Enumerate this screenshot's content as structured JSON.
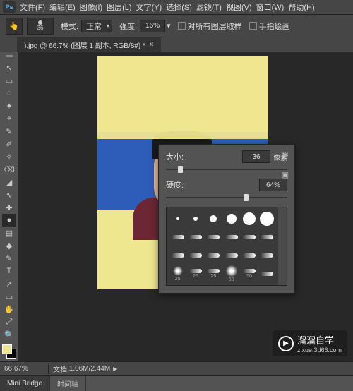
{
  "menubar": {
    "logo": "Ps",
    "items": [
      "文件(F)",
      "编辑(E)",
      "图像(I)",
      "图层(L)",
      "文字(Y)",
      "选择(S)",
      "滤镜(T)",
      "视图(V)",
      "窗口(W)",
      "帮助(H)"
    ]
  },
  "optionbar": {
    "brush_size_chip": "36",
    "mode_label": "模式:",
    "mode_value": "正常",
    "strength_label": "强度:",
    "strength_value": "16%",
    "sample_all_label": "对所有图层取样",
    "finger_paint_label": "手指绘画"
  },
  "tab": {
    "title": ").jpg @ 66.7% (图层 1 副本, RGB/8#) *"
  },
  "toolbox": {
    "tools": [
      "↖",
      "▭",
      "◌",
      "✦",
      "⌖",
      "✎",
      "✐",
      "⟡",
      "⌫",
      "◢",
      "∿",
      "✚",
      "●",
      "▤",
      "◆",
      "✎",
      "T",
      "↗",
      "▭",
      "✋",
      "⤢",
      "🔍"
    ],
    "active_index": 12,
    "fg_color": "#efe690"
  },
  "brush_panel": {
    "size_label": "大小:",
    "size_value": "36",
    "size_unit": "像素",
    "size_pct": 10,
    "hardness_label": "硬度:",
    "hardness_value": "64%",
    "hardness_pct": 64,
    "presets": [
      {
        "type": "dot",
        "d": 4
      },
      {
        "type": "dot",
        "d": 6
      },
      {
        "type": "dot",
        "d": 10
      },
      {
        "type": "dot",
        "d": 14
      },
      {
        "type": "dot",
        "d": 18
      },
      {
        "type": "dot",
        "d": 20
      },
      {
        "type": "spec"
      },
      {
        "type": "spec"
      },
      {
        "type": "spec"
      },
      {
        "type": "spec"
      },
      {
        "type": "spec"
      },
      {
        "type": "spec"
      },
      {
        "type": "spec"
      },
      {
        "type": "spec"
      },
      {
        "type": "spec"
      },
      {
        "type": "spec"
      },
      {
        "type": "spec"
      },
      {
        "type": "spec"
      },
      {
        "type": "soft",
        "d": 14,
        "sz": "25"
      },
      {
        "type": "spec",
        "sz": "25"
      },
      {
        "type": "spec",
        "sz": "25"
      },
      {
        "type": "soft",
        "d": 18,
        "sz": "50"
      },
      {
        "type": "spec",
        "sz": "50"
      },
      {
        "type": "spec"
      }
    ]
  },
  "statusbar": {
    "zoom": "66.67%",
    "docinfo_label": "文档:",
    "docinfo_value": "1.06M/2.44M"
  },
  "footer_tabs": {
    "items": [
      "Mini Bridge",
      "时间轴"
    ],
    "active": 0
  },
  "watermark": {
    "title": "溜溜自学",
    "sub": "zixue.3d66.com"
  }
}
